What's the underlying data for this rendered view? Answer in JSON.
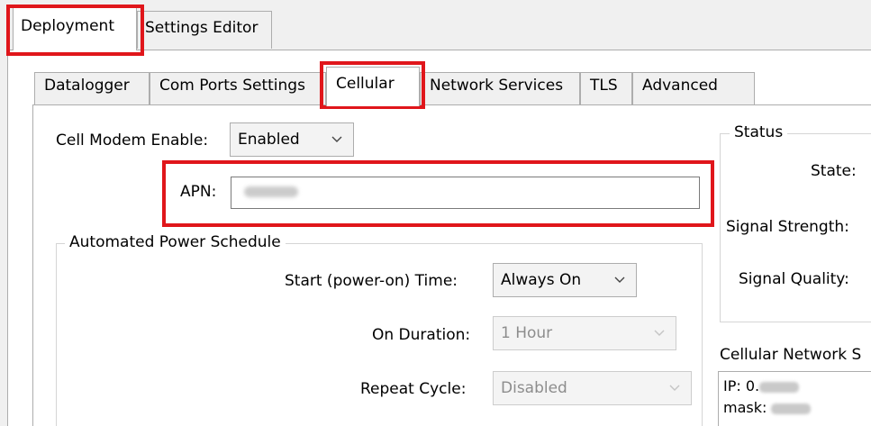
{
  "top_tabs": [
    {
      "label": "Deployment",
      "active": true
    },
    {
      "label": "Settings Editor",
      "active": false
    }
  ],
  "sub_tabs": [
    {
      "label": "Datalogger",
      "active": false
    },
    {
      "label": "Com Ports Settings",
      "active": false
    },
    {
      "label": "Cellular",
      "active": true
    },
    {
      "label": "Network Services",
      "active": false
    },
    {
      "label": "TLS",
      "active": false
    },
    {
      "label": "Advanced",
      "active": false
    }
  ],
  "cellular": {
    "cell_modem_enable_label": "Cell Modem Enable:",
    "cell_modem_enable_value": "Enabled",
    "apn_label": "APN:",
    "power_schedule": {
      "title": "Automated Power Schedule",
      "start_time_label": "Start (power-on) Time:",
      "start_time_value": "Always On",
      "on_duration_label": "On Duration:",
      "on_duration_value": "1 Hour",
      "repeat_cycle_label": "Repeat Cycle:",
      "repeat_cycle_value": "Disabled"
    },
    "status": {
      "title": "Status",
      "state_label": "State:",
      "signal_strength_label": "Signal Strength:",
      "signal_quality_label": "Signal Quality:"
    },
    "network": {
      "title": "Cellular Network S",
      "ip_label": "IP: 0.",
      "mask_label": "mask:"
    }
  },
  "colors": {
    "highlight": "#e0161b",
    "disabled_text": "#8d8d8d"
  }
}
